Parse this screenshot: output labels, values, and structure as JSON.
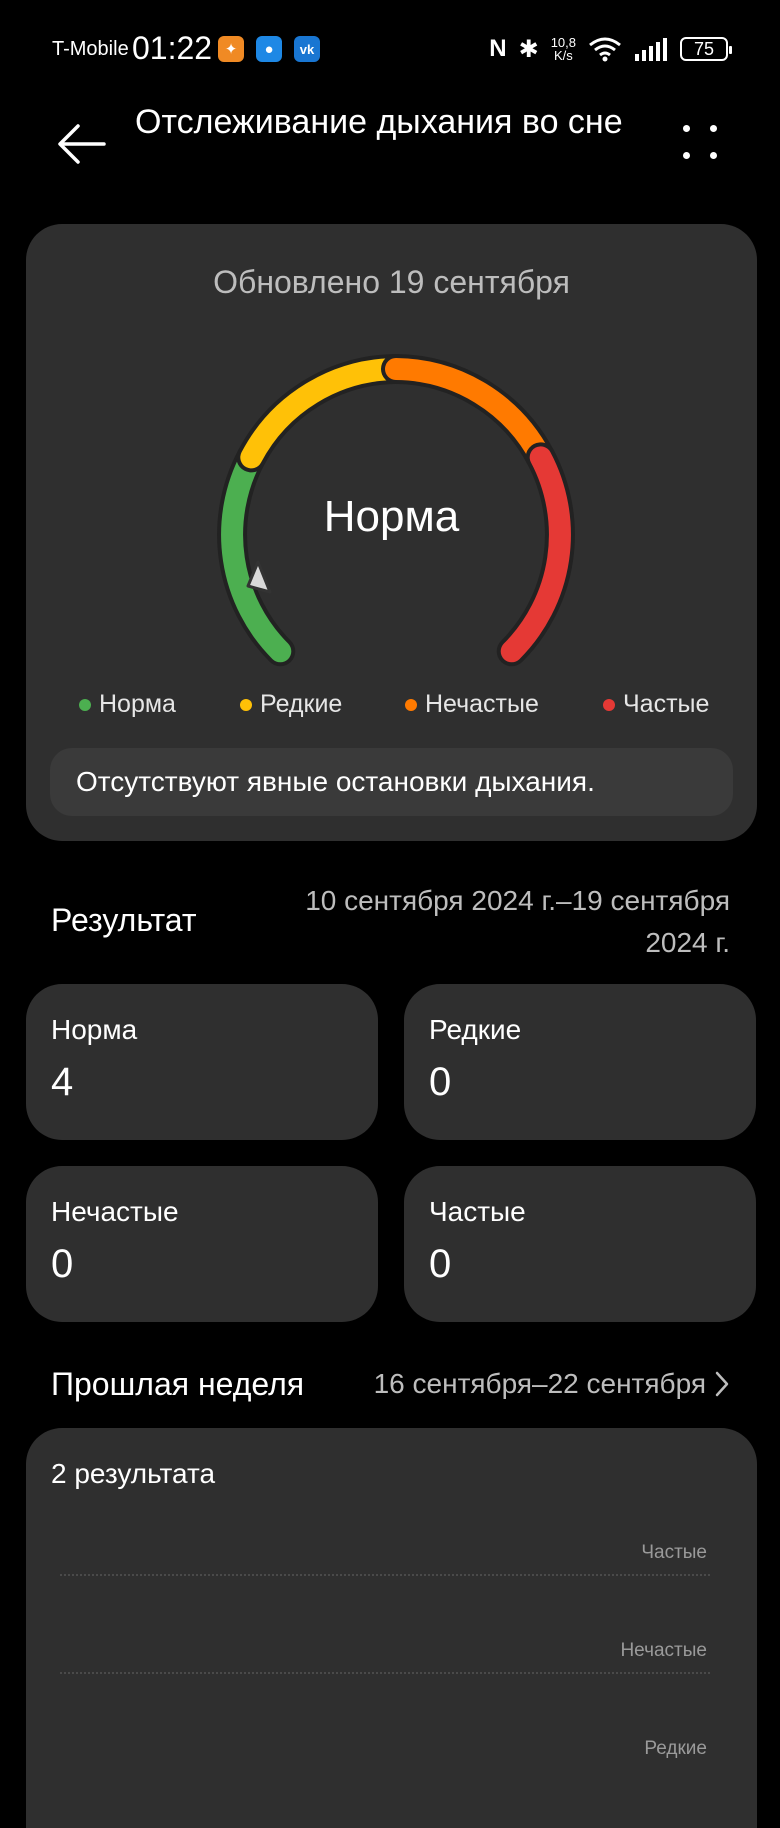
{
  "status_bar": {
    "carrier": "T-Mobile",
    "time": "01:22",
    "net_speed_value": "10,8",
    "net_speed_unit": "K/s",
    "battery": "75"
  },
  "header": {
    "title": "Отслеживание дыхания во сне"
  },
  "gauge_card": {
    "updated": "Обновлено 19 сентября",
    "status": "Норма",
    "legend": [
      {
        "label": "Норма",
        "color": "#4caf50"
      },
      {
        "label": "Редкие",
        "color": "#ffc107"
      },
      {
        "label": "Нечастые",
        "color": "#ff7a00"
      },
      {
        "label": "Частые",
        "color": "#e53935"
      }
    ],
    "note": "Отсутствуют явные остановки дыхания."
  },
  "result": {
    "title": "Результат",
    "range_line1": "10 сентября 2024 г.–19 сентября",
    "range_line2": "2024 г.",
    "stats": [
      {
        "label": "Норма",
        "value": "4"
      },
      {
        "label": "Редкие",
        "value": "0"
      },
      {
        "label": "Нечастые",
        "value": "0"
      },
      {
        "label": "Частые",
        "value": "0"
      }
    ]
  },
  "last_week": {
    "title": "Прошлая неделя",
    "range": "16 сентября–22 сентября",
    "count": "2 результата",
    "axis_labels": [
      "Частые",
      "Нечастые",
      "Редкие"
    ]
  }
}
